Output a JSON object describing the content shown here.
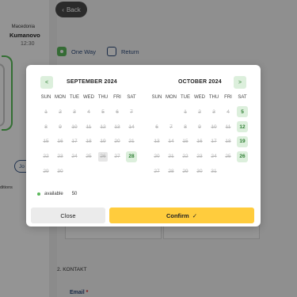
{
  "header": {
    "back_label": "Back"
  },
  "route": {
    "city_from": "Macedonia",
    "city_to": "Kumanovo",
    "time": "12:30",
    "join_label": "Jo",
    "conditions_label": "ditions"
  },
  "trip_type": {
    "one_way": "One Way",
    "return": "Return"
  },
  "section_contact": "2. KONTAKT",
  "email_label": "Email",
  "email_required": "*",
  "datepicker": {
    "prev_icon": "chevron-left-icon",
    "next_icon": "chevron-right-icon",
    "left_month": "SEPTEMBER 2024",
    "right_month": "OCTOBER 2024",
    "weekdays": [
      "SUN",
      "MON",
      "TUE",
      "WED",
      "THU",
      "FRI",
      "SAT"
    ],
    "left_days": [
      {
        "d": "1",
        "s": "x"
      },
      {
        "d": "2",
        "s": "x"
      },
      {
        "d": "3",
        "s": "x"
      },
      {
        "d": "4",
        "s": "x"
      },
      {
        "d": "5",
        "s": "x"
      },
      {
        "d": "6",
        "s": "x"
      },
      {
        "d": "7",
        "s": "x"
      },
      {
        "d": "8",
        "s": "x"
      },
      {
        "d": "9",
        "s": "x"
      },
      {
        "d": "10",
        "s": "x"
      },
      {
        "d": "11",
        "s": "x"
      },
      {
        "d": "12",
        "s": "x"
      },
      {
        "d": "13",
        "s": "x"
      },
      {
        "d": "14",
        "s": "x"
      },
      {
        "d": "15",
        "s": "x"
      },
      {
        "d": "16",
        "s": "x"
      },
      {
        "d": "17",
        "s": "x"
      },
      {
        "d": "18",
        "s": "x"
      },
      {
        "d": "19",
        "s": "x"
      },
      {
        "d": "20",
        "s": "x"
      },
      {
        "d": "21",
        "s": "x"
      },
      {
        "d": "22",
        "s": "x"
      },
      {
        "d": "23",
        "s": "x"
      },
      {
        "d": "24",
        "s": "x"
      },
      {
        "d": "25",
        "s": "x"
      },
      {
        "d": "26",
        "s": "t"
      },
      {
        "d": "27",
        "s": "x"
      },
      {
        "d": "28",
        "s": "a"
      },
      {
        "d": "29",
        "s": "x"
      },
      {
        "d": "30",
        "s": "x"
      }
    ],
    "right_days": [
      {
        "d": "",
        "s": "e"
      },
      {
        "d": "",
        "s": "e"
      },
      {
        "d": "1",
        "s": "x"
      },
      {
        "d": "2",
        "s": "x"
      },
      {
        "d": "3",
        "s": "x"
      },
      {
        "d": "4",
        "s": "x"
      },
      {
        "d": "5",
        "s": "a"
      },
      {
        "d": "6",
        "s": "x"
      },
      {
        "d": "7",
        "s": "x"
      },
      {
        "d": "8",
        "s": "x"
      },
      {
        "d": "9",
        "s": "x"
      },
      {
        "d": "10",
        "s": "x"
      },
      {
        "d": "11",
        "s": "x"
      },
      {
        "d": "12",
        "s": "a"
      },
      {
        "d": "13",
        "s": "x"
      },
      {
        "d": "14",
        "s": "x"
      },
      {
        "d": "15",
        "s": "x"
      },
      {
        "d": "16",
        "s": "x"
      },
      {
        "d": "17",
        "s": "x"
      },
      {
        "d": "18",
        "s": "x"
      },
      {
        "d": "19",
        "s": "a"
      },
      {
        "d": "20",
        "s": "x"
      },
      {
        "d": "21",
        "s": "x"
      },
      {
        "d": "22",
        "s": "x"
      },
      {
        "d": "23",
        "s": "x"
      },
      {
        "d": "24",
        "s": "x"
      },
      {
        "d": "25",
        "s": "x"
      },
      {
        "d": "26",
        "s": "a"
      },
      {
        "d": "27",
        "s": "x"
      },
      {
        "d": "28",
        "s": "x"
      },
      {
        "d": "29",
        "s": "x"
      },
      {
        "d": "30",
        "s": "x"
      },
      {
        "d": "31",
        "s": "x"
      }
    ],
    "legend_label": "available",
    "legend_count": "50",
    "close_label": "Close",
    "confirm_label": "Confirm",
    "confirm_icon": "check-icon"
  },
  "colors": {
    "available_bg": "#dcefdc",
    "available_text": "#2e7d32",
    "confirm_bg": "#ffcc3d",
    "accent": "#5cb85c"
  }
}
